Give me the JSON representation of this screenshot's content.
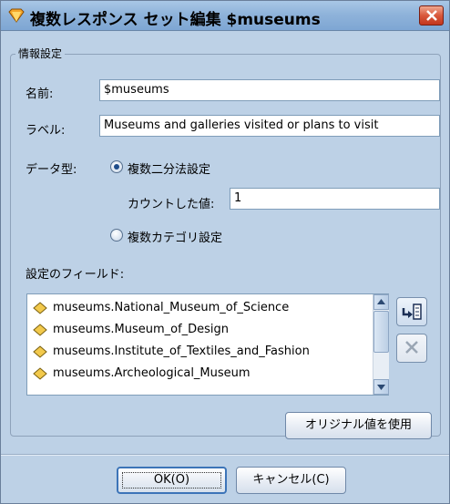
{
  "dialog": {
    "title": "複数レスポンス セット編集 $museums",
    "close_icon": "close-x-icon",
    "title_icon": "spss-diamond-icon"
  },
  "info_group": {
    "legend": "情報設定",
    "name_label": "名前:",
    "name_value": "$museums",
    "label_label": "ラベル:",
    "label_value": "Museums and galleries visited or plans to visit",
    "datatype_label": "データ型:",
    "dichotomy_option": "複数二分法設定",
    "dichotomy_selected": true,
    "counted_value_label": "カウントした値:",
    "counted_value": "1",
    "category_option": "複数カテゴリ設定",
    "fields_label": "設定のフィールド:",
    "fields": [
      "museums.National_Museum_of_Science",
      "museums.Museum_of_Design",
      "museums.Institute_of_Textiles_and_Fashion",
      "museums.Archeological_Museum"
    ],
    "field_icon": "nominal-field-diamond-icon",
    "use_original_button": "オリジナル値を使用"
  },
  "footer": {
    "ok_button": "OK(O)",
    "cancel_button": "キャンセル(C)"
  },
  "colors": {
    "dialog_bg": "#bdd1e6",
    "title_gradient_top": "#a9c7e6",
    "close_button": "#d9583c",
    "field_icon": "#f2c94c"
  }
}
